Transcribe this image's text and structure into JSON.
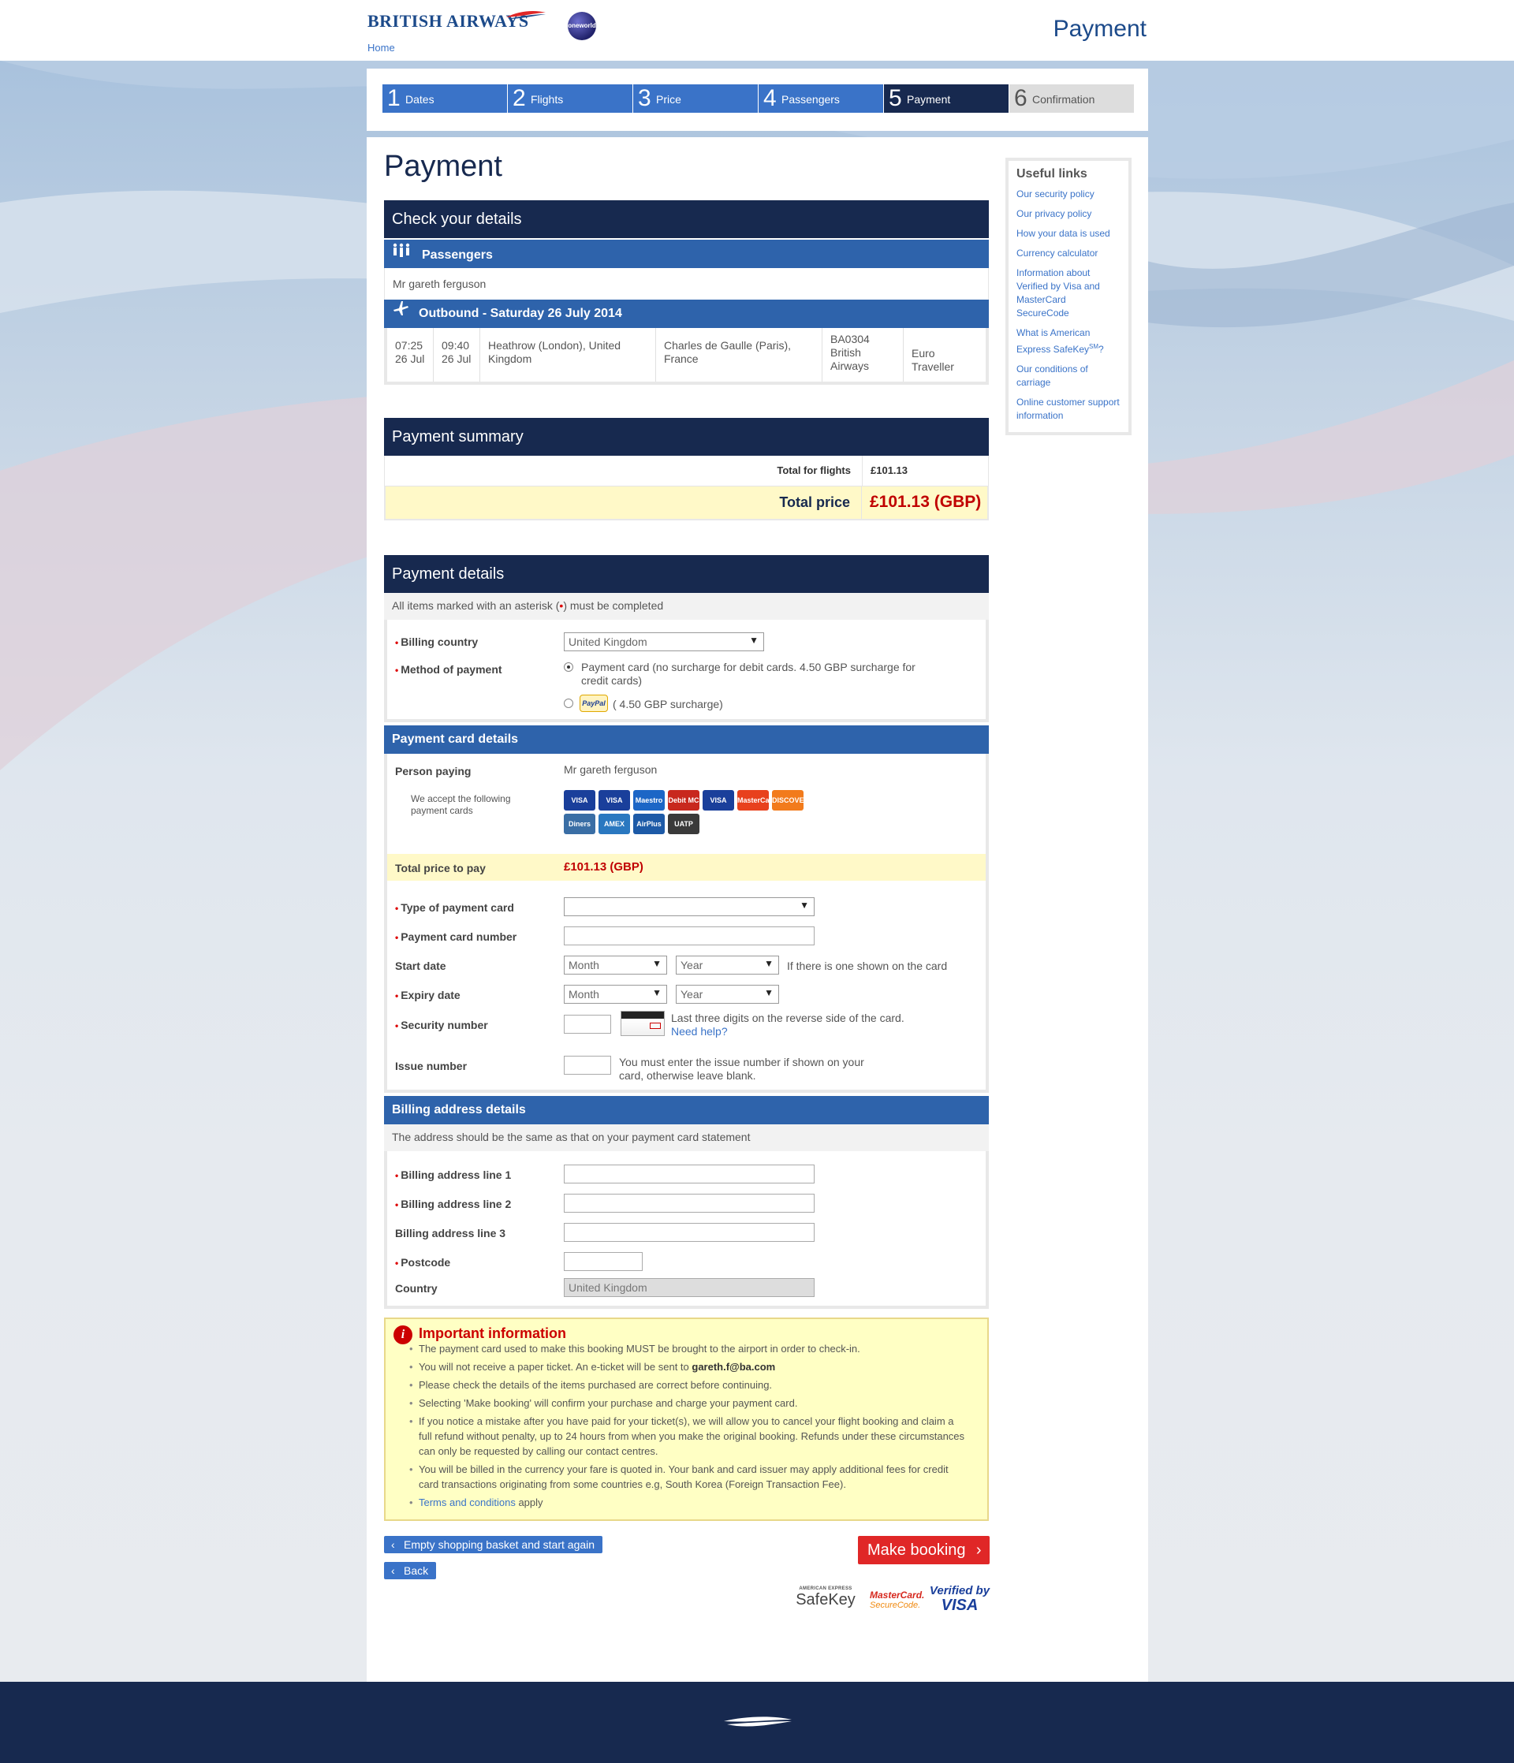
{
  "header": {
    "brand": "BRITISH AIRWAYS",
    "home_link": "Home",
    "oneworld": "oneworld",
    "page_title": "Payment"
  },
  "steps": [
    {
      "num": "1",
      "label": "Dates"
    },
    {
      "num": "2",
      "label": "Flights"
    },
    {
      "num": "3",
      "label": "Price"
    },
    {
      "num": "4",
      "label": "Passengers"
    },
    {
      "num": "5",
      "label": "Payment"
    },
    {
      "num": "6",
      "label": "Confirmation"
    }
  ],
  "heading": "Payment",
  "check_details": {
    "title": "Check your details",
    "passengers_title": "Passengers",
    "passenger_name": "Mr gareth ferguson",
    "outbound_title": "Outbound - Saturday 26 July 2014",
    "flight": {
      "depart_time": "07:25",
      "depart_date": "26 Jul",
      "arrive_time": "09:40",
      "arrive_date": "26 Jul",
      "from": "Heathrow (London), United Kingdom",
      "to": "Charles de Gaulle (Paris), France",
      "flight_no": "BA0304",
      "airline": "British Airways",
      "cabin": "Euro Traveller"
    }
  },
  "payment_summary": {
    "title": "Payment summary",
    "flights_label": "Total for flights",
    "flights_value": "£101.13",
    "total_label": "Total price",
    "total_value": "£101.13 (GBP)"
  },
  "payment_details": {
    "title": "Payment details",
    "note_before": "All items marked with an asterisk (",
    "note_asterisk": "•",
    "note_after": ") must be completed",
    "billing_country_label": "Billing country",
    "billing_country_value": "United Kingdom",
    "method_label": "Method of payment",
    "method_card": "Payment card (no surcharge for debit cards. 4.50 GBP surcharge for credit cards)",
    "method_paypal_logo": "PayPal",
    "method_paypal": "( 4.50 GBP surcharge)"
  },
  "card_details": {
    "title": "Payment card details",
    "person_label": "Person paying",
    "person_value": "Mr gareth ferguson",
    "accept_label": "We accept the following payment cards",
    "cards": [
      {
        "name": "VISA Debit",
        "color": "#1a3f9b"
      },
      {
        "name": "VISA Electron",
        "color": "#1a3f9b"
      },
      {
        "name": "Maestro",
        "color": "#1c66c6"
      },
      {
        "name": "Debit MC",
        "color": "#c8281e"
      },
      {
        "name": "VISA",
        "color": "#1a3f9b"
      },
      {
        "name": "MasterCard",
        "color": "#e8411d"
      },
      {
        "name": "DISCOVER",
        "color": "#f27b1c"
      },
      {
        "name": "Diners Club",
        "color": "#3a6ea5"
      },
      {
        "name": "AMEX",
        "color": "#2a78c0"
      },
      {
        "name": "AirPlus",
        "color": "#1d5aa7"
      },
      {
        "name": "UATP",
        "color": "#3a3a3a"
      }
    ],
    "total_label": "Total price to pay",
    "total_value": "£101.13 (GBP)",
    "type_label": "Type of payment card",
    "number_label": "Payment card number",
    "start_label": "Start date",
    "start_hint": "If there is one shown on the card",
    "expiry_label": "Expiry date",
    "month_placeholder": "Month",
    "year_placeholder": "Year",
    "security_label": "Security number",
    "security_hint": "Last three digits on the reverse side of the card.",
    "need_help": "Need help?",
    "issue_label": "Issue number",
    "issue_hint": "You must enter the issue number if shown on your card, otherwise leave blank."
  },
  "billing": {
    "title": "Billing address details",
    "note": "The address should be the same as that on your payment card statement",
    "line1_label": "Billing address line 1",
    "line2_label": "Billing address line 2",
    "line3_label": "Billing address line 3",
    "postcode_label": "Postcode",
    "country_label": "Country",
    "country_value": "United Kingdom"
  },
  "important": {
    "title": "Important information",
    "items": [
      "The payment card used to make this booking MUST be brought to the airport in order to check-in.",
      "You will not receive a paper ticket. An e-ticket will be sent to ",
      "Please check the details of the items purchased are correct before continuing.",
      "Selecting 'Make booking' will confirm your purchase and charge your payment card.",
      "If you notice a mistake after you have paid for your ticket(s), we will allow you to cancel your flight booking and claim a full refund without penalty, up to 24 hours from when you make the original booking. Refunds under these circumstances can only be requested by calling our contact centres.",
      "You will be billed in the currency your fare is quoted in. Your bank and card issuer may apply additional fees for credit card transactions originating from some countries e.g, South Korea (Foreign Transaction Fee)."
    ],
    "email": "gareth.f@ba.com",
    "terms_link": "Terms and conditions",
    "terms_after": " apply"
  },
  "buttons": {
    "empty_basket": "Empty shopping basket and start again",
    "back": "Back",
    "make_booking": "Make booking"
  },
  "security_logos": {
    "amex_top": "AMERICAN EXPRESS",
    "amex": "SafeKey",
    "mc_top": "MasterCard.",
    "mc": "SecureCode.",
    "visa_top": "Verified by",
    "visa": "VISA"
  },
  "sidebar": {
    "title": "Useful links",
    "links": [
      "Our security policy",
      "Our privacy policy",
      "How your data is used",
      "Currency calculator",
      "Information about Verified by Visa and MasterCard SecureCode",
      "What is American Express SafeKey",
      "Our conditions of carriage",
      "Online customer support information"
    ],
    "safekey_sup": "SM",
    "safekey_q": "?"
  },
  "colors": {
    "navy": "#17294f",
    "blue": "#3a73c8",
    "red": "#e02727",
    "price_red": "#c00000",
    "highlight": "#fff9c8"
  }
}
